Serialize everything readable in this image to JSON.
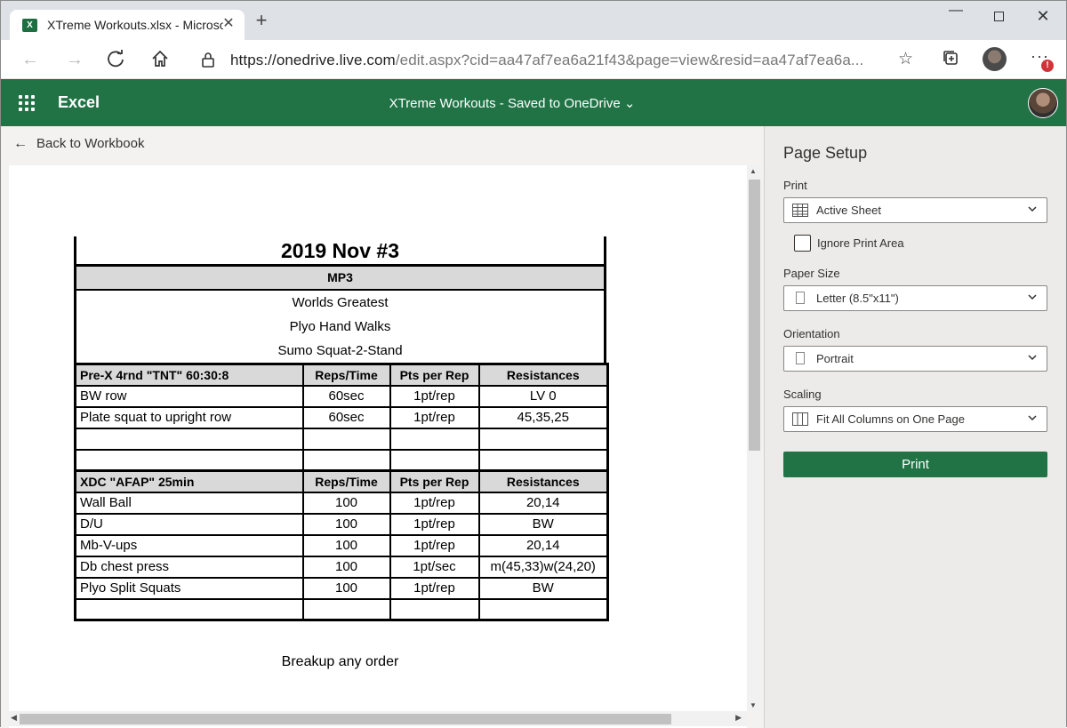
{
  "browser": {
    "tab_title": "XTreme Workouts.xlsx - Microsoft",
    "tab_favicon": "excel-favicon",
    "url_host": "https://onedrive.live.com",
    "url_rest": "/edit.aspx?cid=aa47af7ea6a21f43&page=view&resid=aa47af7ea6a...",
    "notification_badge": "!"
  },
  "excel": {
    "app_name": "Excel",
    "doc_title": "XTreme Workouts  -  Saved to OneDrive ⌄",
    "brand_color": "#217346"
  },
  "nav": {
    "back_label": "Back to Workbook"
  },
  "sheet": {
    "title": "2019 Nov #3",
    "subtitle": "MP3",
    "lines": [
      "Worlds Greatest",
      "Plyo Hand Walks",
      "Sumo Squat-2-Stand"
    ],
    "sections": [
      {
        "header": [
          "Pre-X  4rnd \"TNT\" 60:30:8",
          "Reps/Time",
          "Pts per Rep",
          "Resistances"
        ],
        "rows": [
          [
            "BW row",
            "60sec",
            "1pt/rep",
            "LV 0"
          ],
          [
            "Plate squat to upright row",
            "60sec",
            "1pt/rep",
            "45,35,25"
          ],
          [
            "",
            "",
            "",
            ""
          ],
          [
            "",
            "",
            "",
            ""
          ]
        ]
      },
      {
        "header": [
          "XDC \"AFAP\" 25min",
          "Reps/Time",
          "Pts per Rep",
          "Resistances"
        ],
        "rows": [
          [
            "Wall Ball",
            "100",
            "1pt/rep",
            "20,14"
          ],
          [
            "D/U",
            "100",
            "1pt/rep",
            "BW"
          ],
          [
            "Mb-V-ups",
            "100",
            "1pt/rep",
            "20,14"
          ],
          [
            "Db chest press",
            "100",
            "1pt/sec",
            "m(45,33)w(24,20)"
          ],
          [
            "Plyo Split Squats",
            "100",
            "1pt/rep",
            "BW"
          ],
          [
            "",
            "",
            "",
            ""
          ]
        ]
      }
    ],
    "footer_note": "Breakup any order"
  },
  "page_setup": {
    "heading": "Page Setup",
    "print_label": "Print",
    "print_value": "Active Sheet",
    "ignore_print_area_label": "Ignore Print Area",
    "ignore_print_area_checked": false,
    "paper_size_label": "Paper Size",
    "paper_size_value": "Letter (8.5\"x11\")",
    "orientation_label": "Orientation",
    "orientation_value": "Portrait",
    "scaling_label": "Scaling",
    "scaling_value": "Fit All Columns on One Page",
    "print_button": "Print"
  }
}
